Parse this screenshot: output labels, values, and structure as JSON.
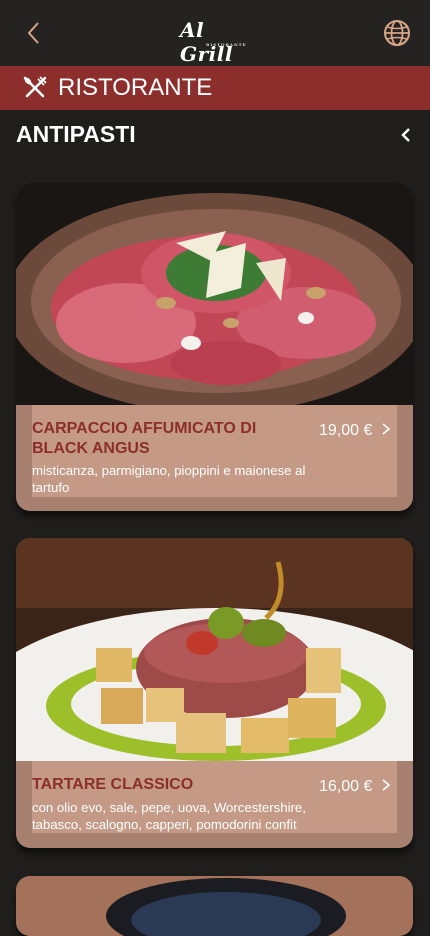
{
  "header": {
    "logo_text": "Al Grill",
    "logo_subtext": "RISTORANTE",
    "back_icon": "chevron-left-icon",
    "globe_icon": "globe-icon"
  },
  "section": {
    "title": "RISTORANTE",
    "icon": "fork-knife-icon"
  },
  "category": {
    "title": "ANTIPASTI",
    "collapse_icon": "chevron-left-icon"
  },
  "dishes": [
    {
      "name": "CARPACCIO AFFUMICATO DI BLACK ANGUS",
      "price": "19,00 €",
      "description": "misticanza, parmigiano, pioppini e maionese al tartufo"
    },
    {
      "name": "TARTARE CLASSICO",
      "price": "16,00 €",
      "description": "con olio evo, sale, pepe, uova, Worcestershire, tabasco, scalogno, capperi, pomodorini confit"
    }
  ],
  "colors": {
    "header_bg": "#242322",
    "section_bar": "#8b2e2c",
    "card_bg": "#a78070",
    "card_info_bg": "#c49a86",
    "dish_name": "#8b2e2c",
    "icon_accent": "#d9a586"
  }
}
